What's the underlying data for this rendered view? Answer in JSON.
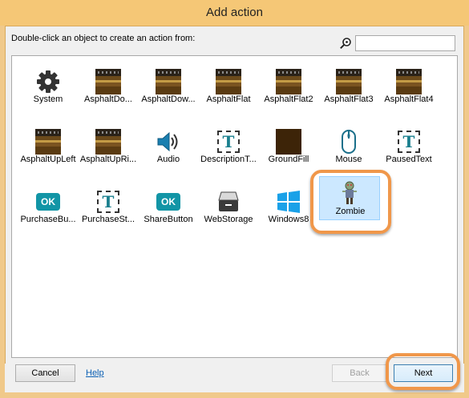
{
  "window": {
    "title": "Add action"
  },
  "instruction": "Double-click an object to create an action from:",
  "search": {
    "placeholder": "",
    "value": ""
  },
  "objects": [
    {
      "label": "System",
      "icon": "gear-icon"
    },
    {
      "label": "AsphaltDo...",
      "icon": "asphalt-tile-icon"
    },
    {
      "label": "AsphaltDow...",
      "icon": "asphalt-tile-icon"
    },
    {
      "label": "AsphaltFlat",
      "icon": "asphalt-tile-icon"
    },
    {
      "label": "AsphaltFlat2",
      "icon": "asphalt-tile-icon"
    },
    {
      "label": "AsphaltFlat3",
      "icon": "asphalt-tile-icon"
    },
    {
      "label": "AsphaltFlat4",
      "icon": "asphalt-tile-icon"
    },
    {
      "label": "AsphaltUpLeft",
      "icon": "asphalt-tile-icon"
    },
    {
      "label": "AsphaltUpRi...",
      "icon": "asphalt-tile-icon"
    },
    {
      "label": "Audio",
      "icon": "speaker-icon"
    },
    {
      "label": "DescriptionT...",
      "icon": "text-object-icon"
    },
    {
      "label": "GroundFill",
      "icon": "ground-fill-icon"
    },
    {
      "label": "Mouse",
      "icon": "mouse-icon"
    },
    {
      "label": "PausedText",
      "icon": "text-object-icon"
    },
    {
      "label": "PurchaseBu...",
      "icon": "ok-button-icon"
    },
    {
      "label": "PurchaseSt...",
      "icon": "text-object-icon"
    },
    {
      "label": "ShareButton",
      "icon": "ok-button-icon"
    },
    {
      "label": "WebStorage",
      "icon": "storage-icon"
    },
    {
      "label": "Windows8",
      "icon": "windows-logo-icon"
    },
    {
      "label": "Zombie",
      "icon": "zombie-sprite-icon",
      "selected": true
    }
  ],
  "footer": {
    "cancel_label": "Cancel",
    "help_label": "Help",
    "back_label": "Back",
    "next_label": "Next"
  },
  "colors": {
    "title_bar": "#f5c776",
    "selection": "#cce8ff",
    "highlight_ring": "#f0974a",
    "link": "#0a5fb4",
    "teal_accent": "#1295a6"
  }
}
